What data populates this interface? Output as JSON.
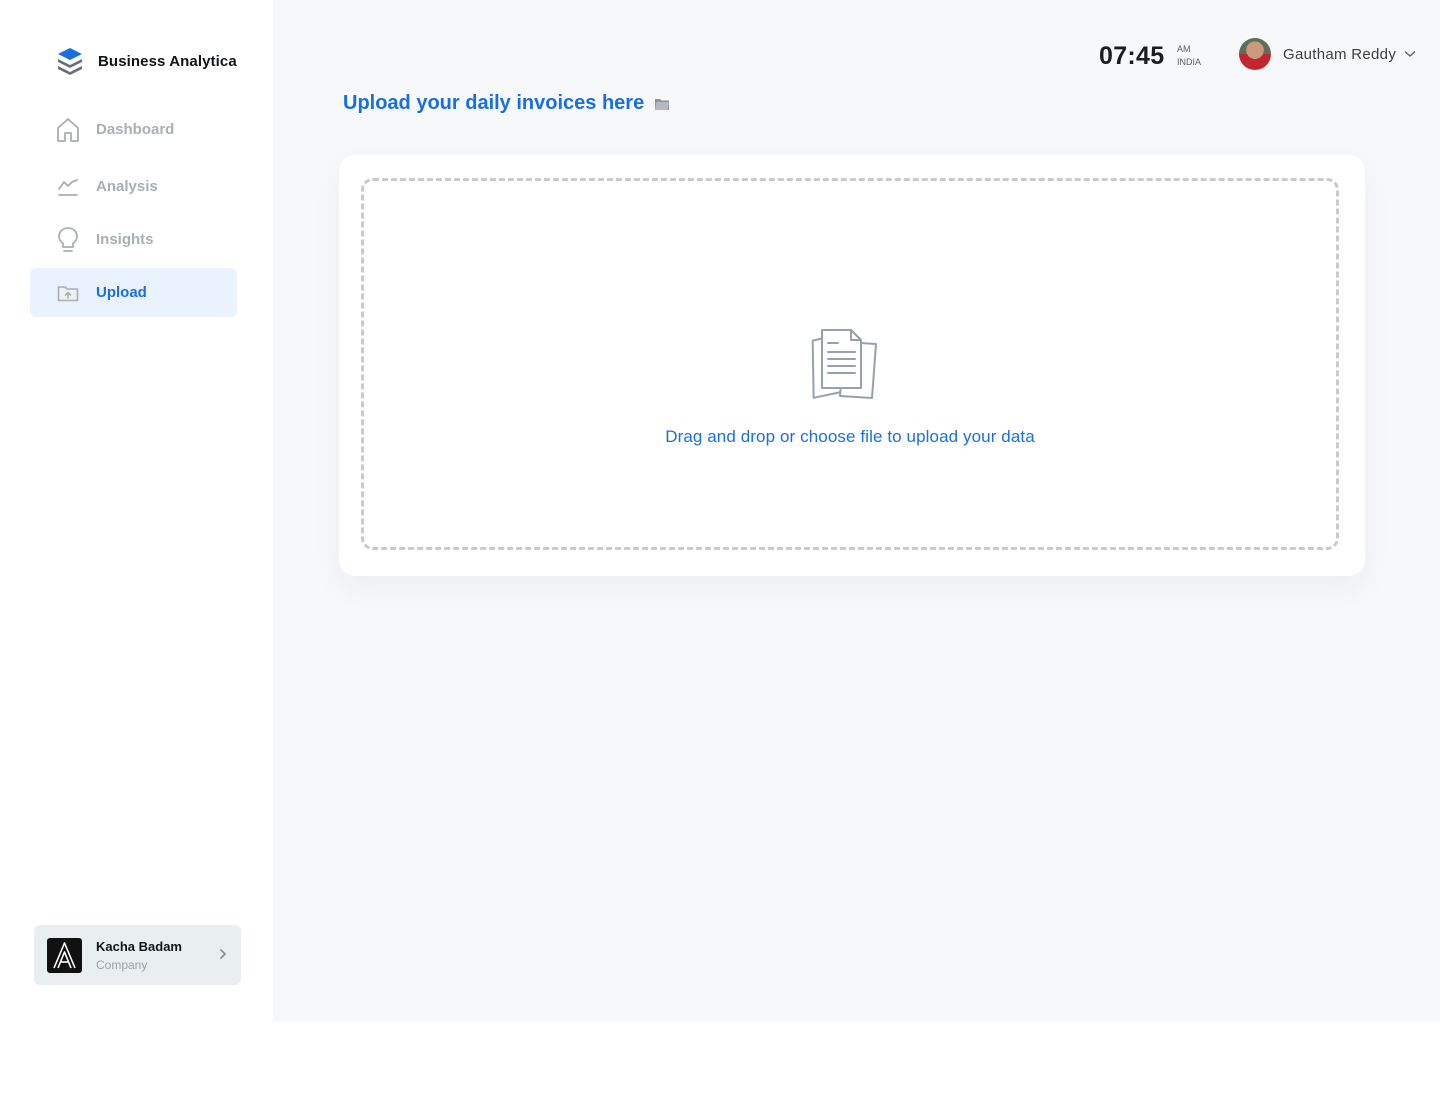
{
  "app": {
    "brand_name": "Business Analytica"
  },
  "sidebar": {
    "items": [
      {
        "label": "Dashboard",
        "icon": "home-icon",
        "active": false
      },
      {
        "label": "Analysis",
        "icon": "chart-line-icon",
        "active": false
      },
      {
        "label": "Insights",
        "icon": "lightbulb-icon",
        "active": false
      },
      {
        "label": "Upload",
        "icon": "folder-upload-icon",
        "active": true
      }
    ],
    "company": {
      "name": "Kacha Badam",
      "type": "Company"
    }
  },
  "header": {
    "time": "07:45",
    "period": "AM",
    "region": "INDIA",
    "user_name": "Gautham Reddy"
  },
  "main": {
    "title": "Upload your daily invoices here",
    "dropzone_text": "Drag and drop or choose file to upload your data"
  },
  "colors": {
    "accent": "#1a6fe0",
    "active_bg": "#eaf2fe",
    "muted_text": "#a9afb5",
    "page_bg": "#f7f8fa"
  }
}
